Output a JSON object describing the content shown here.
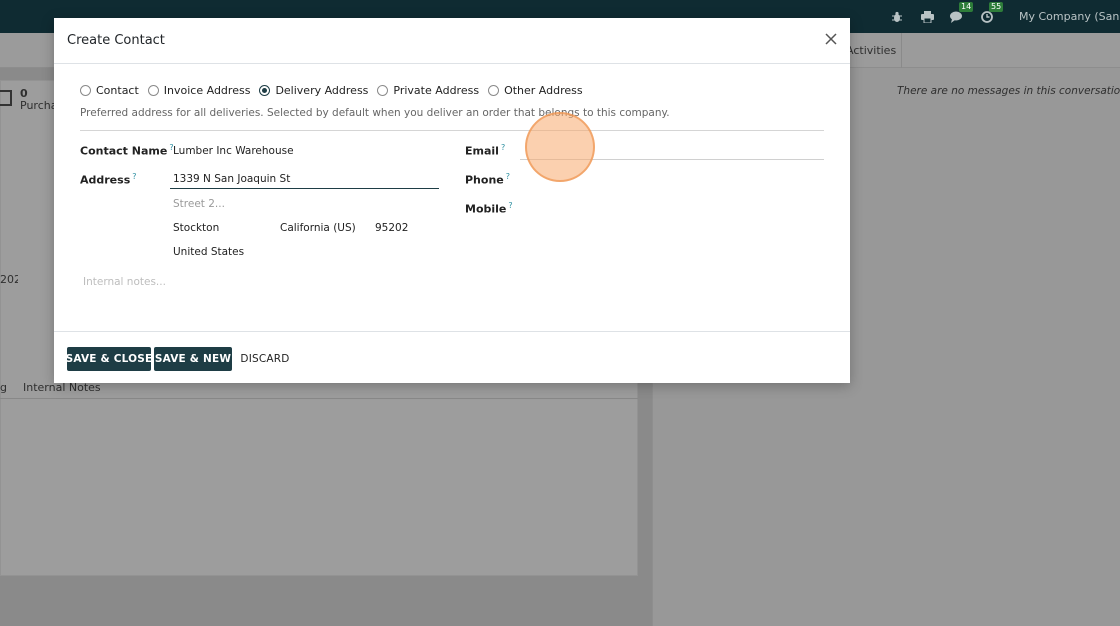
{
  "navbar": {
    "chat_badge": "14",
    "activity_badge": "55",
    "company": "My Company (San Francisco)"
  },
  "background": {
    "activities_tab": "Activities",
    "purchase_count": "0",
    "purchase_label": "Purchases",
    "zip_fragment": "202",
    "tab_fragment": "g",
    "internal_notes_tab": "Internal Notes",
    "no_messages": "There are no messages in this conversation."
  },
  "modal": {
    "title": "Create Contact",
    "address_types": [
      {
        "label": "Contact",
        "checked": false
      },
      {
        "label": "Invoice Address",
        "checked": false
      },
      {
        "label": "Delivery Address",
        "checked": true
      },
      {
        "label": "Private Address",
        "checked": false
      },
      {
        "label": "Other Address",
        "checked": false
      }
    ],
    "hint": "Preferred address for all deliveries. Selected by default when you deliver an order that belongs to this company.",
    "fields": {
      "contact_name_label": "Contact Name",
      "contact_name_value": "Lumber Inc Warehouse",
      "address_label": "Address",
      "street": "1339 N San Joaquin St",
      "street2_placeholder": "Street 2...",
      "city": "Stockton",
      "state": "California (US)",
      "zip": "95202",
      "country": "United States",
      "email_label": "Email",
      "phone_label": "Phone",
      "mobile_label": "Mobile",
      "internal_notes_placeholder": "Internal notes..."
    },
    "help_marker": "?",
    "buttons": {
      "save_close": "SAVE & CLOSE",
      "save_new": "SAVE & NEW",
      "discard": "DISCARD"
    }
  }
}
